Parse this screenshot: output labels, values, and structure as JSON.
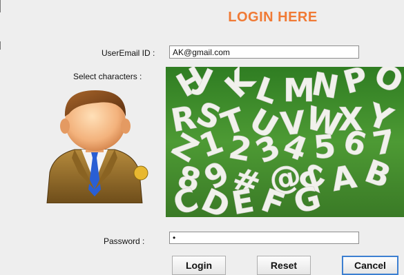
{
  "form": {
    "title": "LOGIN HERE",
    "email_label": "UserEmail ID :",
    "email_value": "AK@gmail.com",
    "select_label": "Select characters :",
    "password_label": "Password :",
    "password_value": "•"
  },
  "buttons": {
    "login": "Login",
    "reset": "Reset",
    "cancel": "Cancel"
  },
  "character_grid": {
    "letters": [
      "H",
      "J",
      "K",
      "L",
      "M",
      "N",
      "P",
      "O",
      "R",
      "S",
      "T",
      "U",
      "V",
      "W",
      "X",
      "Y",
      "Z",
      "1",
      "2",
      "3",
      "4",
      "5",
      "6",
      "7",
      "8",
      "9",
      "#",
      "@",
      "&",
      "A",
      "B",
      "C",
      "D",
      "E",
      "F",
      "G"
    ]
  },
  "colors": {
    "title": "#f07a35",
    "focus_border": "#3c7fd1",
    "grass": "#3e8a2a"
  }
}
